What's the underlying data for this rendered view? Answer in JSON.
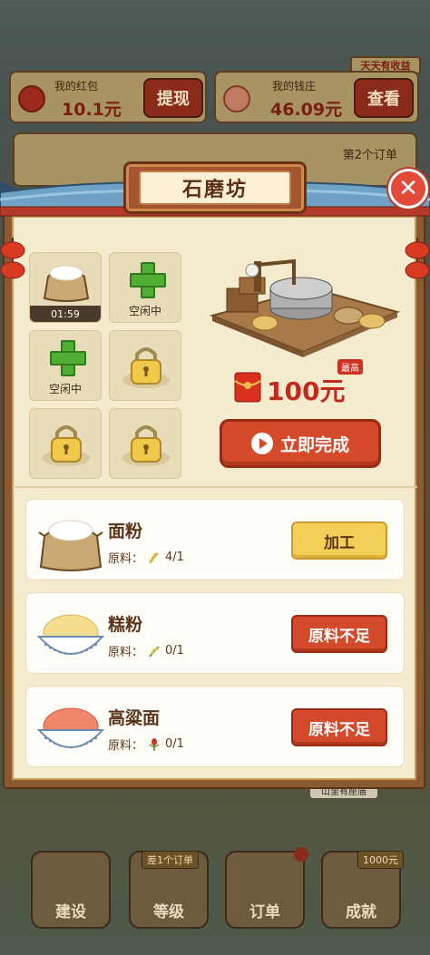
{
  "background": {
    "wallet_left": {
      "label": "我的红包",
      "value": "10.1元",
      "button": "提现"
    },
    "wallet_right": {
      "label": "我的钱庄",
      "value": "46.09元",
      "button": "查看",
      "tag": "天天有收益"
    },
    "order_card": {
      "text": "第2个订单"
    },
    "sign": "山里有座庙",
    "nav": [
      {
        "label": "建设"
      },
      {
        "label": "等级",
        "tag": "差1个订单"
      },
      {
        "label": "订单"
      },
      {
        "label": "成就",
        "tag": "1000元"
      }
    ]
  },
  "modal": {
    "title": "石磨坊",
    "close_icon": "close-icon",
    "slots": [
      {
        "state": "busy",
        "timer": "01:59",
        "icon": "flour-sack-icon"
      },
      {
        "state": "idle",
        "label": "空闲中",
        "icon": "plus-icon"
      },
      {
        "state": "idle",
        "label": "空闲中",
        "icon": "plus-icon"
      },
      {
        "state": "locked",
        "icon": "lock-icon"
      },
      {
        "state": "locked",
        "icon": "lock-icon"
      },
      {
        "state": "locked",
        "icon": "lock-icon"
      }
    ],
    "reward": {
      "amount": "100元",
      "badge": "最高",
      "icon": "red-envelope-icon"
    },
    "complete_button": "立即完成",
    "recipes": [
      {
        "name": "面粉",
        "material_label": "原料：",
        "material_count": "4/1",
        "material_icon": "wheat-icon",
        "action": "加工",
        "action_type": "process"
      },
      {
        "name": "糕粉",
        "material_label": "原料：",
        "material_count": "0/1",
        "material_icon": "rice-icon",
        "action": "原料不足",
        "action_type": "shortage"
      },
      {
        "name": "高粱面",
        "material_label": "原料：",
        "material_count": "0/1",
        "material_icon": "sorghum-icon",
        "action": "原料不足",
        "action_type": "shortage"
      }
    ]
  },
  "colors": {
    "accent_red": "#d44a2a",
    "process_yellow": "#f4cf58",
    "panel_cream": "#f5eccf"
  }
}
